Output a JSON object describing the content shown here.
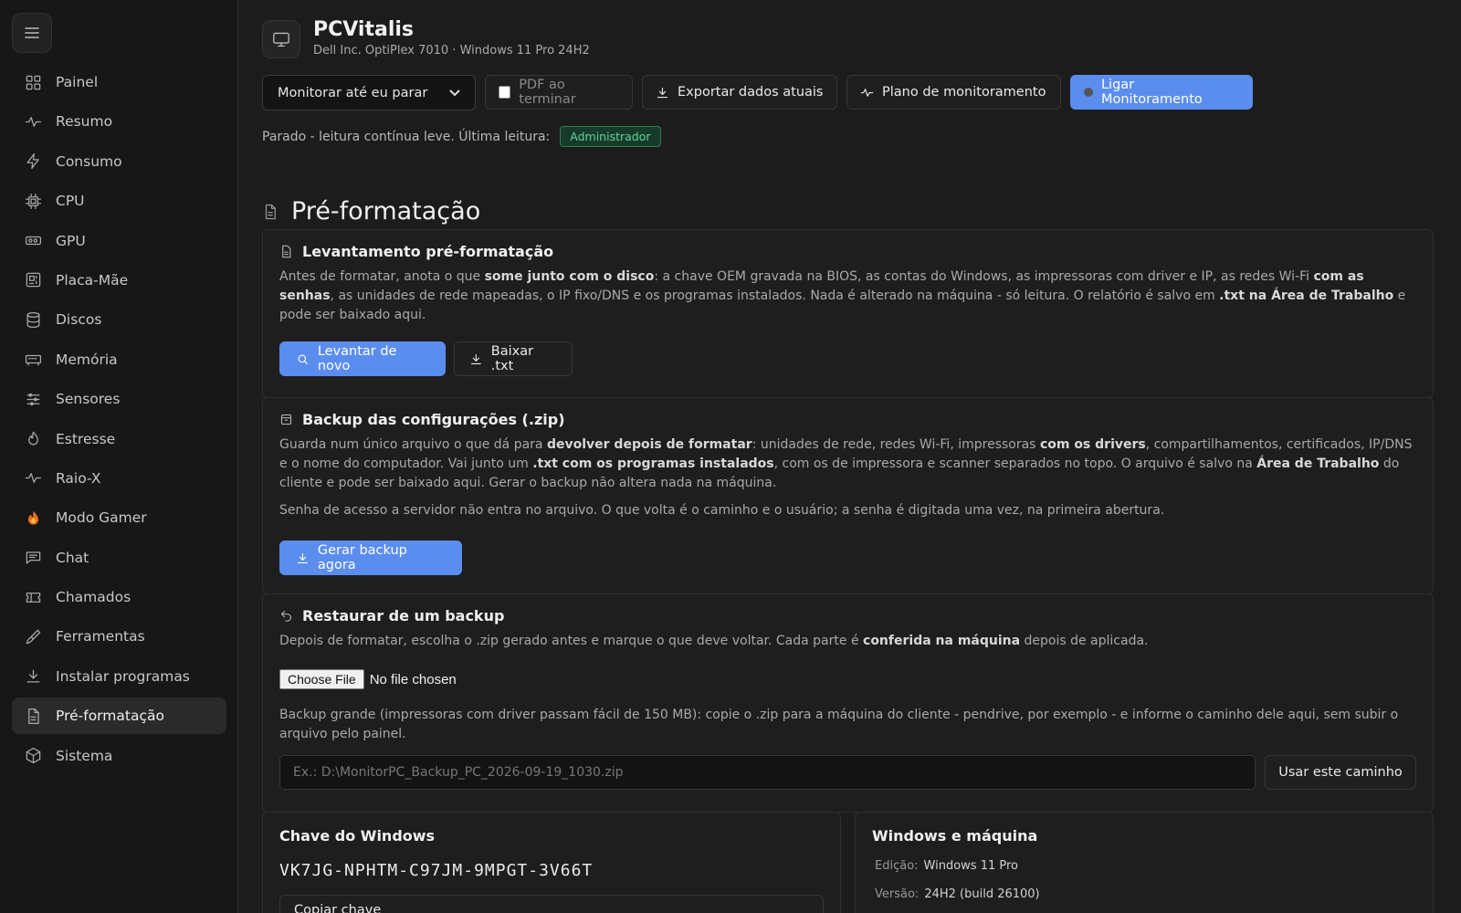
{
  "app": {
    "title": "PCVitalis",
    "subtitle": "Dell Inc. OptiPlex 7010 · Windows 11 Pro 24H2"
  },
  "sidebar": {
    "items": [
      {
        "label": "Painel",
        "icon": "grid-icon"
      },
      {
        "label": "Resumo",
        "icon": "pulse-icon"
      },
      {
        "label": "Consumo",
        "icon": "bolt-icon"
      },
      {
        "label": "CPU",
        "icon": "cpu-icon"
      },
      {
        "label": "GPU",
        "icon": "gpu-icon"
      },
      {
        "label": "Placa-Mãe",
        "icon": "motherboard-icon"
      },
      {
        "label": "Discos",
        "icon": "database-icon"
      },
      {
        "label": "Memória",
        "icon": "memory-icon"
      },
      {
        "label": "Sensores",
        "icon": "sliders-icon"
      },
      {
        "label": "Estresse",
        "icon": "flame-outline-icon"
      },
      {
        "label": "Raio-X",
        "icon": "pulse-icon"
      },
      {
        "label": "Modo Gamer",
        "icon": "fire-emoji-icon"
      },
      {
        "label": "Chat",
        "icon": "chat-icon"
      },
      {
        "label": "Chamados",
        "icon": "ticket-icon"
      },
      {
        "label": "Ferramentas",
        "icon": "brush-icon"
      },
      {
        "label": "Instalar programas",
        "icon": "download-icon"
      },
      {
        "label": "Pré-formatação",
        "icon": "document-icon",
        "active": true
      },
      {
        "label": "Sistema",
        "icon": "box-icon"
      }
    ]
  },
  "toolbar": {
    "select_value": "Monitorar até eu parar",
    "pdf_label": "PDF ao terminar",
    "export_label": "Exportar dados atuais",
    "plan_label": "Plano de monitoramento",
    "start_label": "Ligar Monitoramento"
  },
  "status": {
    "text": "Parado - leitura contínua leve. Última leitura:",
    "badge": "Administrador"
  },
  "section": {
    "title": "Pré-formatação"
  },
  "survey": {
    "title": "Levantamento pré-formatação",
    "t1": "Antes de formatar, anota o que ",
    "b1": "some junto com o disco",
    "t2": ": a chave OEM gravada na BIOS, as contas do Windows, as impressoras com driver e IP, as redes Wi-Fi ",
    "b2": "com as senhas",
    "t3": ", as unidades de rede mapeadas, o IP fixo/DNS e os programas instalados. Nada é alterado na máquina - só leitura. O relatório é salvo em ",
    "b3": ".txt na Área de Trabalho",
    "t4": " e pode ser baixado aqui.",
    "btn_rerun": "Levantar de novo",
    "btn_download": "Baixar .txt"
  },
  "backup": {
    "title": "Backup das configurações (.zip)",
    "t1": "Guarda num único arquivo o que dá para ",
    "b1": "devolver depois de formatar",
    "t2": ": unidades de rede, redes Wi-Fi, impressoras ",
    "b2": "com os drivers",
    "t3": ", compartilhamentos, certificados, IP/DNS e o nome do computador. Vai junto um ",
    "b3": ".txt com os programas instalados",
    "t4": ", com os de impressora e scanner separados no topo. O arquivo é salvo na ",
    "b4": "Área de Trabalho",
    "t5": " do cliente e pode ser baixado aqui. Gerar o backup não altera nada na máquina.",
    "note": "Senha de acesso a servidor não entra no arquivo. O que volta é o caminho e o usuário; a senha é digitada uma vez, na primeira abertura.",
    "btn_generate": "Gerar backup agora"
  },
  "restore": {
    "title": "Restaurar de um backup",
    "t1": "Depois de formatar, escolha o .zip gerado antes e marque o que deve voltar. Cada parte é ",
    "b1": "conferida na máquina",
    "t2": " depois de aplicada.",
    "file_btn": "Choose File",
    "file_status": "No file chosen",
    "large_note": "Backup grande (impressoras com driver passam fácil de 150 MB): copie o .zip para a máquina do cliente - pendrive, por exemplo - e informe o caminho dele aqui, sem subir o arquivo pelo painel.",
    "path_placeholder": "Ex.: D:\\MonitorPC_Backup_PC_2026-09-19_1030.zip",
    "btn_use_path": "Usar este caminho"
  },
  "windows_key": {
    "title": "Chave do Windows",
    "key": "VK7JG-NPHTM-C97JM-9MPGT-3V66T",
    "btn_copy": "Copiar chave"
  },
  "machine": {
    "title": "Windows e máquina",
    "edition_label": "Edição:",
    "edition_value": "Windows 11 Pro",
    "version_label": "Versão:",
    "version_value": "24H2 (build 26100)"
  },
  "colors": {
    "accent": "#5b8def",
    "badge_green": "#5fd39a",
    "background": "#1c1c1c"
  }
}
